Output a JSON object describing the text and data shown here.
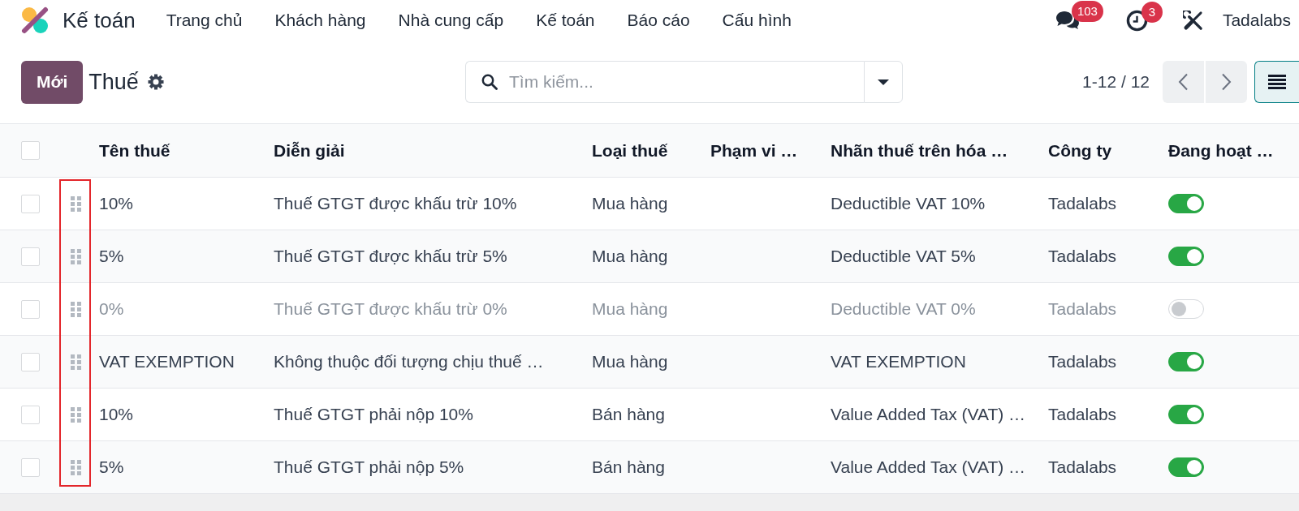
{
  "app": {
    "name": "Kế toán"
  },
  "menu": [
    "Trang chủ",
    "Khách hàng",
    "Nhà cung cấp",
    "Kế toán",
    "Báo cáo",
    "Cấu hình"
  ],
  "systray": {
    "messages_badge": "103",
    "activities_badge": "3",
    "company": "Tadalabs"
  },
  "control_panel": {
    "new_button": "Mới",
    "title": "Thuế",
    "search": {
      "placeholder": "Tìm kiếm..."
    },
    "pager": "1-12 / 12"
  },
  "table": {
    "select_all_checked": false,
    "handle_column_highlighted": true,
    "columns": [
      "Tên thuế",
      "Diễn giải",
      "Loại thuế",
      "Phạm vi …",
      "Nhãn thuế trên hóa …",
      "Công ty",
      "Đang hoạt …"
    ],
    "rows": [
      {
        "checked": false,
        "name": "10%",
        "description": "Thuế GTGT được khấu trừ 10%",
        "tax_type": "Mua hàng",
        "invoice_label": "Deductible VAT 10%",
        "company": "Tadalabs",
        "active": true
      },
      {
        "checked": false,
        "name": "5%",
        "description": "Thuế GTGT được khấu trừ 5%",
        "tax_type": "Mua hàng",
        "invoice_label": "Deductible VAT 5%",
        "company": "Tadalabs",
        "active": true
      },
      {
        "checked": false,
        "name": "0%",
        "description": "Thuế GTGT được khấu trừ 0%",
        "tax_type": "Mua hàng",
        "invoice_label": "Deductible VAT 0%",
        "company": "Tadalabs",
        "active": false
      },
      {
        "checked": false,
        "name": "VAT EXEMPTION",
        "description": "Không thuộc đối tượng chịu thuế …",
        "tax_type": "Mua hàng",
        "invoice_label": "VAT EXEMPTION",
        "company": "Tadalabs",
        "active": true
      },
      {
        "checked": false,
        "name": "10%",
        "description": "Thuế GTGT phải nộp 10%",
        "tax_type": "Bán hàng",
        "invoice_label": "Value Added Tax (VAT) …",
        "company": "Tadalabs",
        "active": true
      },
      {
        "checked": false,
        "name": "5%",
        "description": "Thuế GTGT phải nộp 5%",
        "tax_type": "Bán hàng",
        "invoice_label": "Value Added Tax (VAT) …",
        "company": "Tadalabs",
        "active": true
      }
    ]
  }
}
